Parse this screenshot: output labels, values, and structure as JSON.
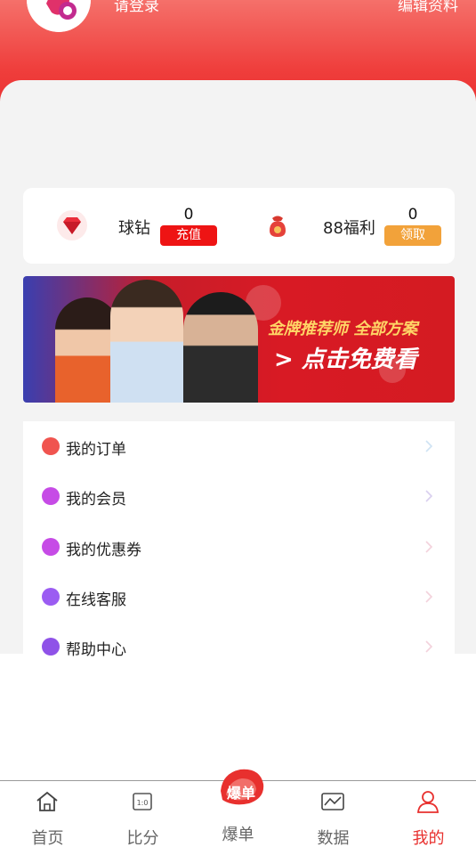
{
  "header": {
    "login_prompt": "请登录",
    "edit_profile": "编辑资料"
  },
  "wallet": {
    "diamond": {
      "label": "球钻",
      "count": "0",
      "button": "充值",
      "button_color": "#ee1414"
    },
    "welfare": {
      "label": "88福利",
      "count": "0",
      "button": "领取",
      "button_color": "#f2a23a"
    }
  },
  "banner": {
    "title": "金牌推荐师 全部方案",
    "cta": "> 点击免费看"
  },
  "menu": {
    "items": [
      {
        "label": "我的订单",
        "icon": "order-icon",
        "color": "#f0544f"
      },
      {
        "label": "我的会员",
        "icon": "vip-icon",
        "color": "#c64be6"
      },
      {
        "label": "我的优惠券",
        "icon": "coupon-icon",
        "color": "#c64be6"
      },
      {
        "label": "在线客服",
        "icon": "service-icon",
        "color": "#9b5cf2"
      },
      {
        "label": "帮助中心",
        "icon": "help-icon",
        "color": "#8f52e8"
      }
    ]
  },
  "tabbar": {
    "items": [
      {
        "label": "首页",
        "icon": "home-icon"
      },
      {
        "label": "比分",
        "icon": "score-icon"
      },
      {
        "label": "爆单",
        "icon": "hot-icon"
      },
      {
        "label": "数据",
        "icon": "data-icon"
      },
      {
        "label": "我的",
        "icon": "profile-icon",
        "active": true
      }
    ],
    "center_badge_text": "爆单",
    "active_color": "#e8302e"
  }
}
